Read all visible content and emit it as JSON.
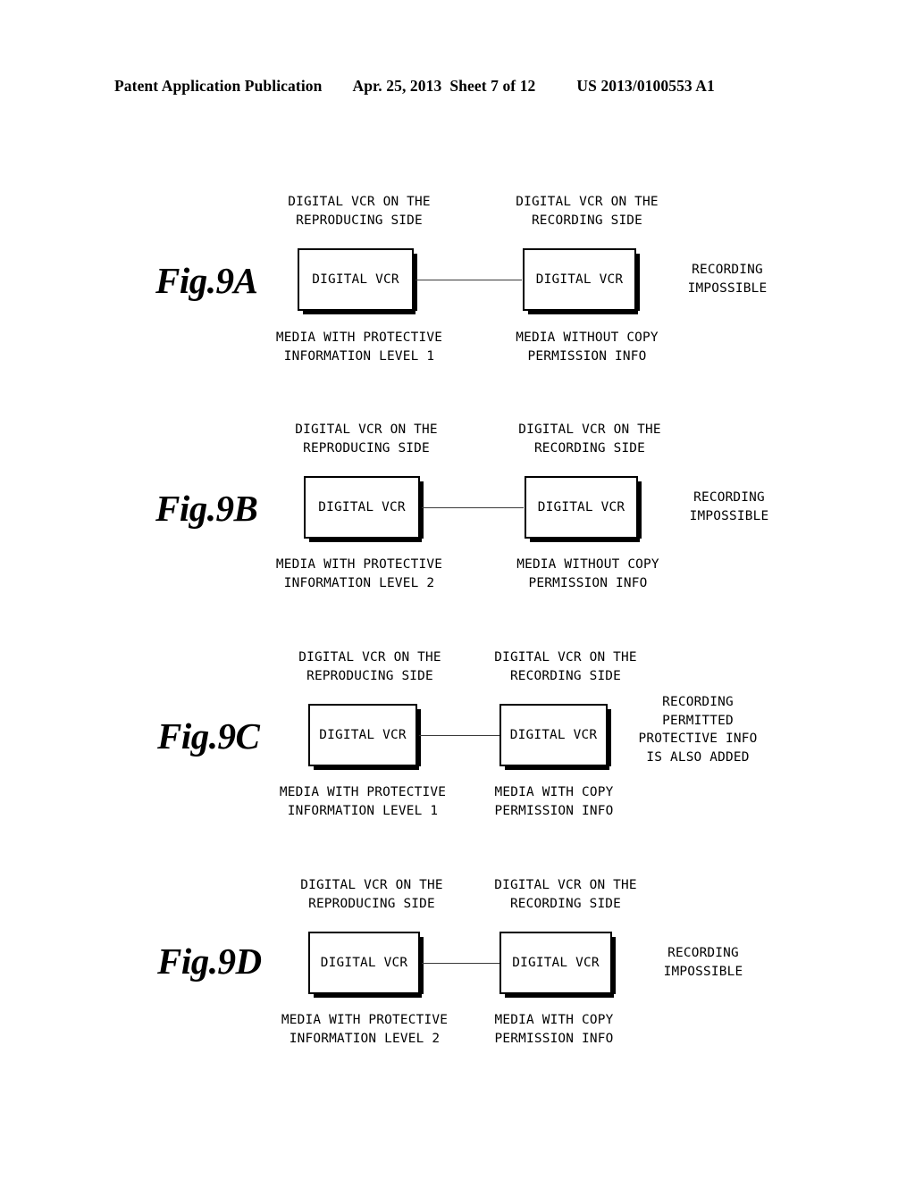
{
  "header": {
    "publication": "Patent Application Publication",
    "date": "Apr. 25, 2013",
    "sheet": "Sheet 7 of 12",
    "patent_number": "US 2013/0100553 A1"
  },
  "common": {
    "box_label": "DIGITAL VCR",
    "reproducing_side_label": "DIGITAL VCR ON THE\nREPRODUCING SIDE",
    "recording_side_label": "DIGITAL VCR ON THE\nRECORDING SIDE"
  },
  "figures": [
    {
      "id": "fig-9a",
      "label": "Fig.9A",
      "left": {
        "top_label": "DIGITAL VCR ON THE\nREPRODUCING SIDE",
        "box_label": "DIGITAL VCR",
        "bottom_label": "MEDIA WITH PROTECTIVE\nINFORMATION LEVEL 1"
      },
      "right": {
        "top_label": "DIGITAL VCR ON THE\nRECORDING SIDE",
        "box_label": "DIGITAL VCR",
        "bottom_label": "MEDIA WITHOUT COPY\nPERMISSION INFO",
        "side_label": "RECORDING\nIMPOSSIBLE"
      }
    },
    {
      "id": "fig-9b",
      "label": "Fig.9B",
      "left": {
        "top_label": "DIGITAL VCR ON THE\nREPRODUCING SIDE",
        "box_label": "DIGITAL VCR",
        "bottom_label": "MEDIA WITH PROTECTIVE\nINFORMATION LEVEL 2"
      },
      "right": {
        "top_label": "DIGITAL VCR ON THE\nRECORDING SIDE",
        "box_label": "DIGITAL VCR",
        "bottom_label": "MEDIA WITHOUT COPY\nPERMISSION INFO",
        "side_label": "RECORDING\nIMPOSSIBLE"
      }
    },
    {
      "id": "fig-9c",
      "label": "Fig.9C",
      "left": {
        "top_label": "DIGITAL VCR ON THE\nREPRODUCING SIDE",
        "box_label": "DIGITAL VCR",
        "bottom_label": "MEDIA WITH PROTECTIVE\nINFORMATION LEVEL 1"
      },
      "right": {
        "top_label": "DIGITAL VCR ON THE\nRECORDING SIDE",
        "box_label": "DIGITAL VCR",
        "bottom_label": "MEDIA WITH COPY\nPERMISSION INFO",
        "side_label": "RECORDING\nPERMITTED\nPROTECTIVE INFO\nIS ALSO ADDED"
      }
    },
    {
      "id": "fig-9d",
      "label": "Fig.9D",
      "left": {
        "top_label": "DIGITAL VCR ON THE\nREPRODUCING SIDE",
        "box_label": "DIGITAL VCR",
        "bottom_label": "MEDIA WITH PROTECTIVE\nINFORMATION LEVEL 2"
      },
      "right": {
        "top_label": "DIGITAL VCR ON THE\nRECORDING SIDE",
        "box_label": "DIGITAL VCR",
        "bottom_label": "MEDIA WITH COPY\nPERMISSION INFO",
        "side_label": "RECORDING\nIMPOSSIBLE"
      }
    }
  ]
}
